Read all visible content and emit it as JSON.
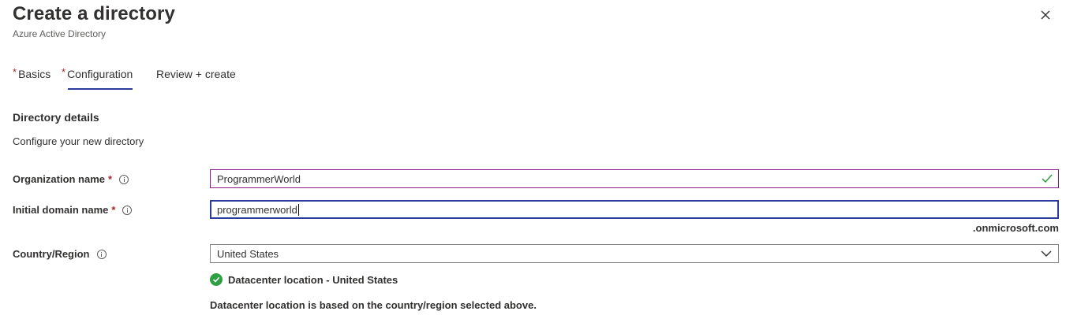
{
  "header": {
    "title": "Create a directory",
    "subtitle": "Azure Active Directory",
    "close_icon": "close-icon"
  },
  "tabs": [
    {
      "label": "Basics",
      "required": "*",
      "active": false
    },
    {
      "label": "Configuration",
      "required": "*",
      "active": true
    },
    {
      "label": "Review + create",
      "required": "",
      "active": false
    }
  ],
  "section": {
    "title": "Directory details",
    "description": "Configure your new directory"
  },
  "fields": {
    "org_name": {
      "label": "Organization name",
      "required": "*",
      "value": "ProgrammerWorld",
      "status_icon": "checkmark-icon"
    },
    "domain_name": {
      "label": "Initial domain name",
      "required": "*",
      "value": "programmerworld",
      "suffix": ".onmicrosoft.com"
    },
    "country": {
      "label": "Country/Region",
      "value": "United States",
      "dropdown_icon": "chevron-down-icon"
    }
  },
  "datacenter": {
    "location_text": "Datacenter location - United States",
    "note": "Datacenter location is based on the country/region selected above."
  },
  "colors": {
    "accent": "#2a3b9b",
    "required": "#a4262c",
    "success": "#2ea043",
    "valid_border": "#8a1b8d"
  }
}
